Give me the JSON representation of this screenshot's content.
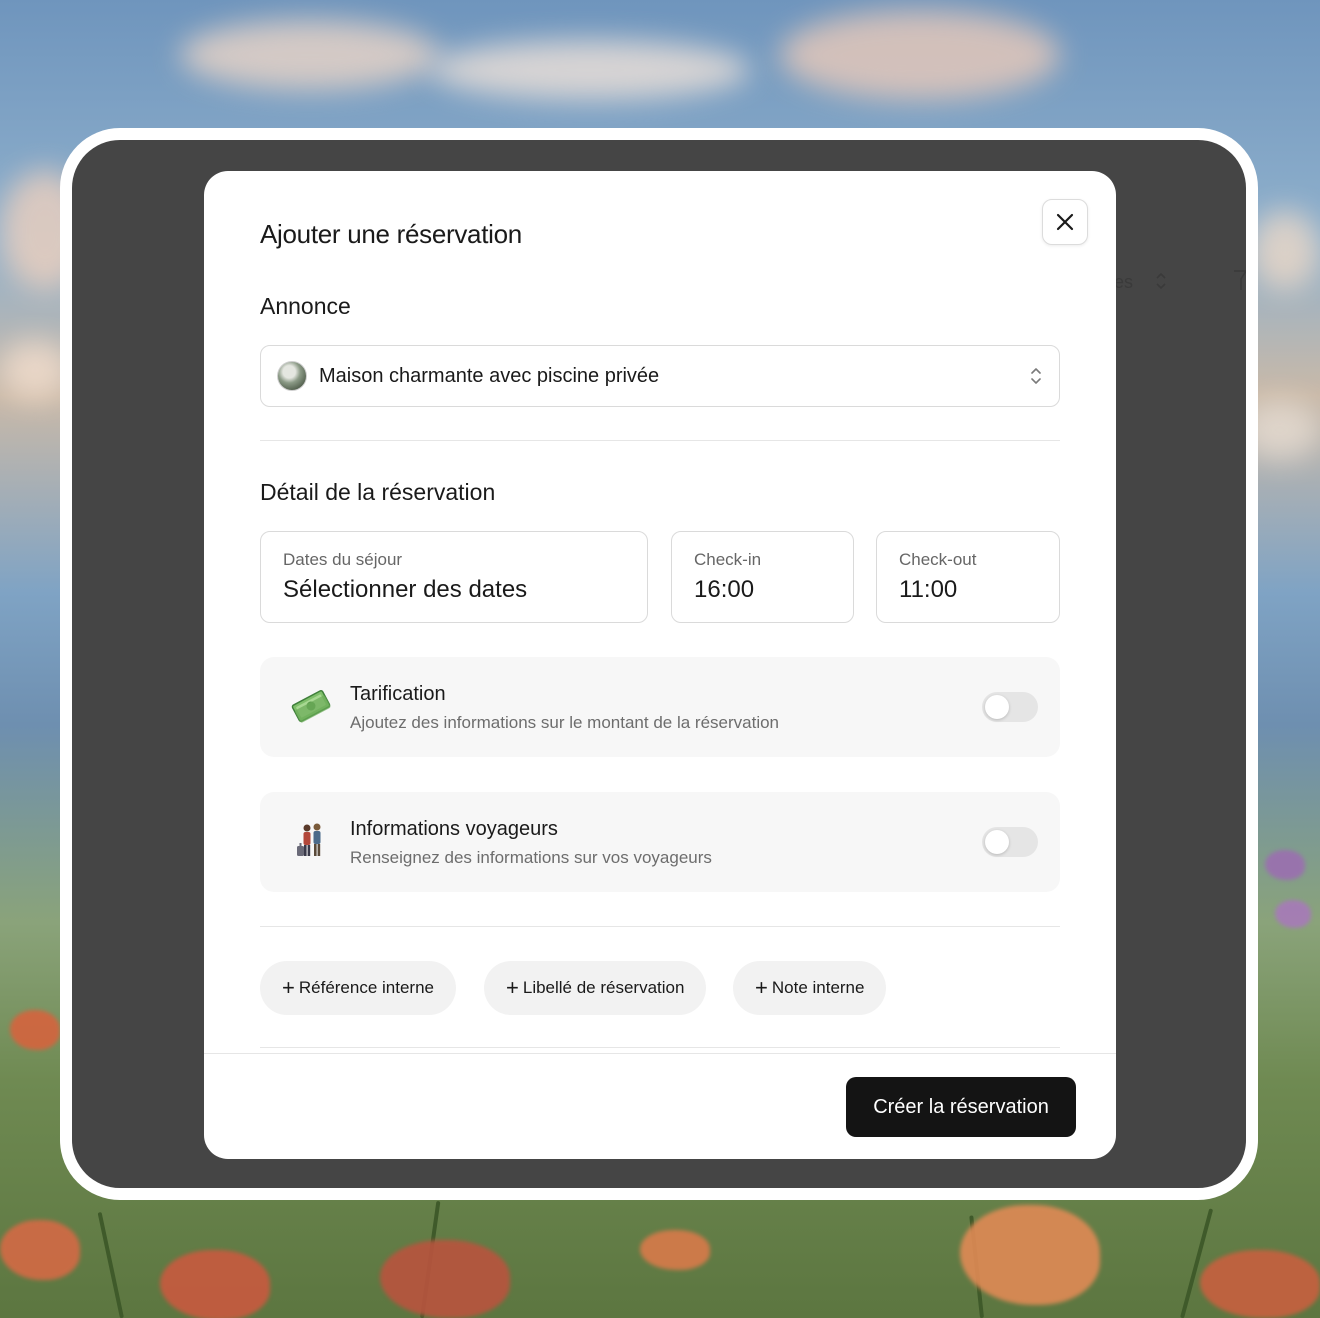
{
  "modal": {
    "title": "Ajouter une réservation",
    "listing_section_label": "Annonce",
    "listing_select": {
      "value": "Maison charmante avec piscine privée"
    },
    "details_section_label": "Détail de la réservation",
    "dates_field": {
      "label": "Dates du séjour",
      "value": "Sélectionner des dates"
    },
    "checkin_field": {
      "label": "Check-in",
      "value": "16:00"
    },
    "checkout_field": {
      "label": "Check-out",
      "value": "11:00"
    },
    "pricing": {
      "title": "Tarification",
      "description": "Ajoutez des informations sur le montant de la réservation",
      "enabled": false,
      "icon": "money-icon"
    },
    "guests": {
      "title": "Informations voyageurs",
      "description": "Renseignez des informations sur vos voyageurs",
      "enabled": false,
      "icon": "travelers-icon"
    },
    "chips": [
      {
        "label": "Référence interne"
      },
      {
        "label": "Libellé de réservation"
      },
      {
        "label": "Note interne"
      }
    ],
    "create_button_label": "Créer la réservation"
  },
  "background_app": {
    "ghost_text": "es"
  },
  "colors": {
    "accent": "#141414",
    "overlay": "#454545"
  }
}
